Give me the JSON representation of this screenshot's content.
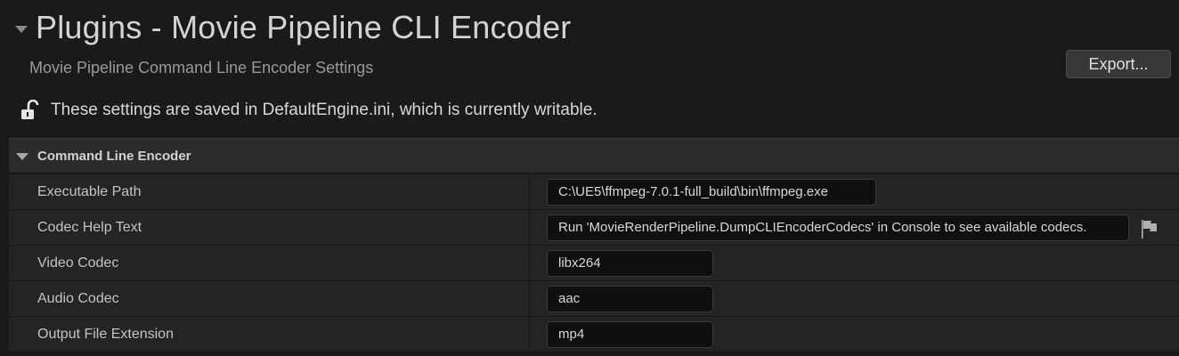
{
  "header": {
    "title": "Plugins - Movie Pipeline CLI Encoder",
    "subtitle": "Movie Pipeline Command Line Encoder Settings",
    "export_label": "Export...",
    "notice": "These settings are saved in DefaultEngine.ini, which is currently writable."
  },
  "category": {
    "label": "Command Line Encoder"
  },
  "properties": [
    {
      "label": "Executable Path",
      "value": "C:\\UE5\\ffmpeg-7.0.1-full_build\\bin\\ffmpeg.exe"
    },
    {
      "label": "Codec Help Text",
      "value": "Run 'MovieRenderPipeline.DumpCLIEncoderCodecs' in Console to see available codecs."
    },
    {
      "label": "Video Codec",
      "value": "libx264"
    },
    {
      "label": "Audio Codec",
      "value": "aac"
    },
    {
      "label": "Output File Extension",
      "value": "mp4"
    }
  ],
  "icons": {
    "lock": "unlocked-padlock-icon",
    "flag": "flag-icon"
  }
}
